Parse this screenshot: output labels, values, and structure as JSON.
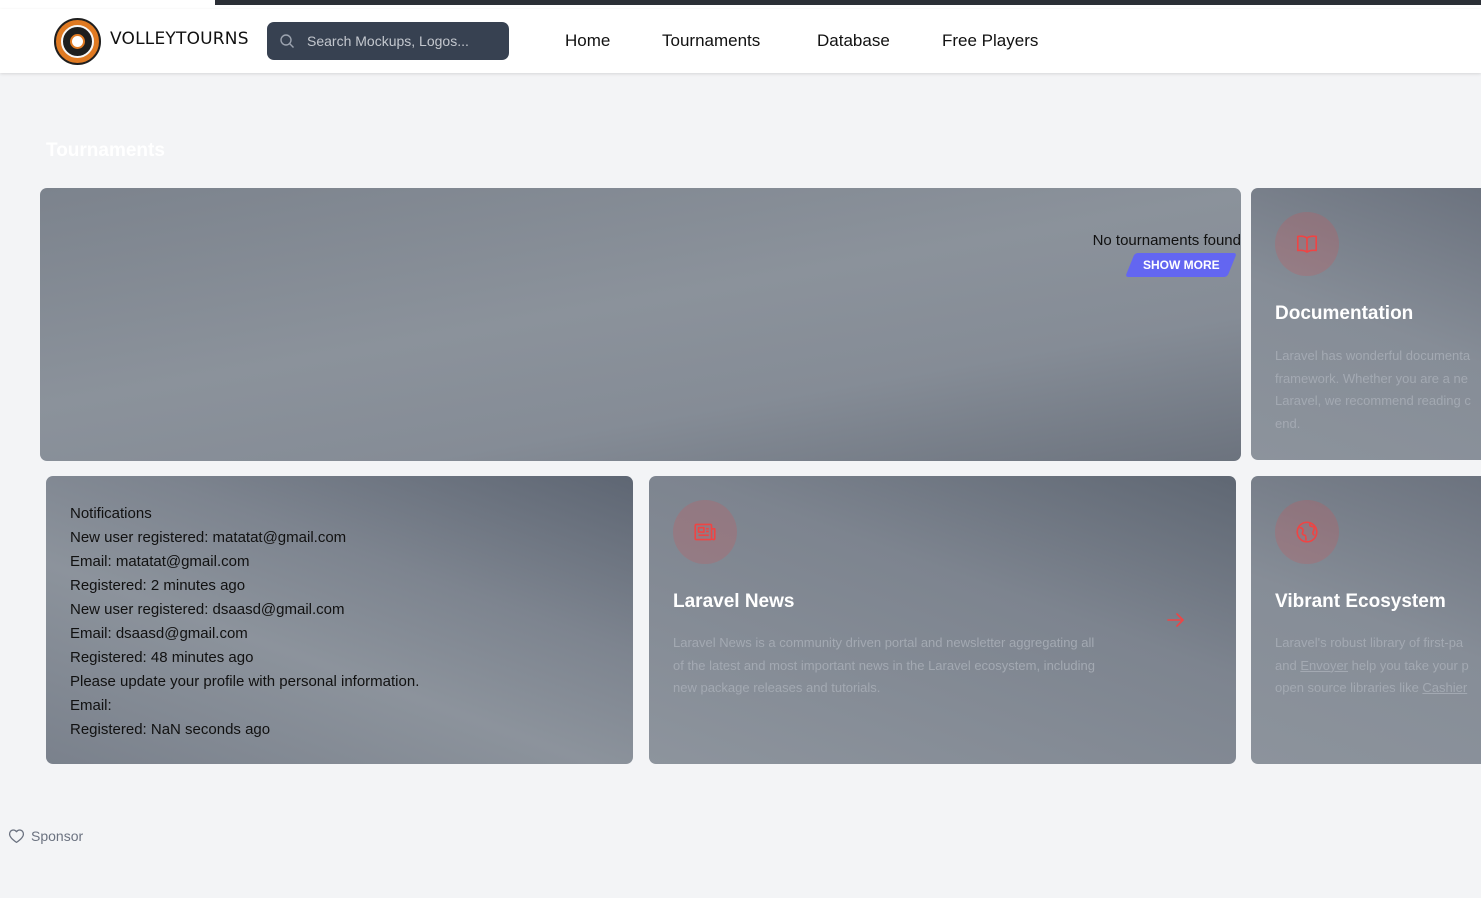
{
  "navbar": {
    "brand": "VOLLEYTOURNS",
    "search_placeholder": "Search Mockups, Logos...",
    "links": [
      "Home",
      "Tournaments",
      "Database",
      "Free Players"
    ]
  },
  "tournaments": {
    "heading": "Tournaments",
    "empty_message": "No tournaments found",
    "show_more_label": "SHOW MORE"
  },
  "notifications": {
    "lines": [
      "Notifications",
      "New user registered: matatat@gmail.com",
      "Email: matatat@gmail.com",
      "Registered: 2 minutes ago",
      "New user registered: dsaasd@gmail.com",
      "Email: dsaasd@gmail.com",
      "Registered: 48 minutes ago",
      "Please update your profile with personal information.",
      "Email:",
      "Registered: NaN seconds ago"
    ]
  },
  "features": {
    "documentation": {
      "icon": "book-icon",
      "title": "Documentation",
      "desc": [
        "Laravel has wonderful documenta",
        "framework. Whether you are a ne",
        "Laravel, we recommend reading c",
        "end."
      ]
    },
    "news": {
      "icon": "newspaper-icon",
      "title": "Laravel News",
      "desc": [
        "Laravel News is a community driven portal and newsletter aggregating all",
        "of the latest and most important news in the Laravel ecosystem, including",
        "new package releases and tutorials."
      ]
    },
    "ecosystem": {
      "icon": "globe-icon",
      "title": "Vibrant Ecosystem",
      "desc_line1": "Laravel's robust library of first-pa",
      "desc_line2_pre": "and ",
      "desc_line2_link": "Envoyer",
      "desc_line2_post": " help you take your p",
      "desc_line3_pre": "open source libraries like ",
      "desc_line3_link": "Cashier"
    }
  },
  "footer": {
    "sponsor_label": "Sponsor"
  },
  "colors": {
    "accent": "#6366f1",
    "icon_red": "#ef4444",
    "nav_search_bg": "#374151"
  }
}
